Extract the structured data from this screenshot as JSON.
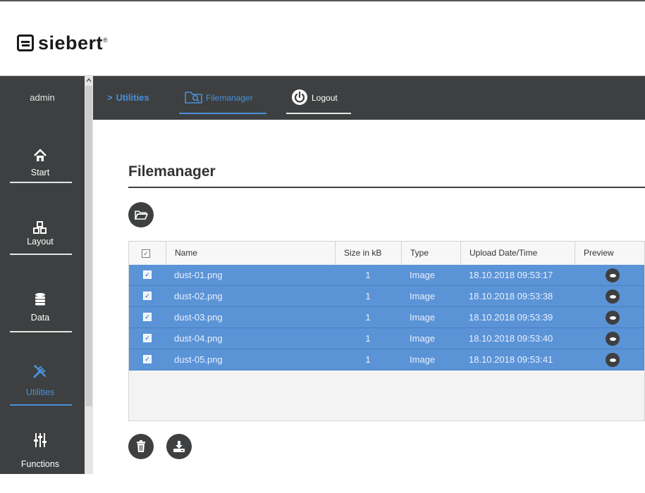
{
  "brand": {
    "name": "siebert",
    "mark": "®"
  },
  "sidebar": {
    "user": "admin",
    "items": [
      {
        "label": "Start",
        "icon": "home-icon"
      },
      {
        "label": "Layout",
        "icon": "layout-icon"
      },
      {
        "label": "Data",
        "icon": "database-icon"
      },
      {
        "label": "Utilities",
        "icon": "tools-icon",
        "active": true
      },
      {
        "label": "Functions",
        "icon": "sliders-icon"
      }
    ]
  },
  "nav": {
    "breadcrumb_chevron": ">",
    "breadcrumb": "Utilities",
    "filemanager_label": "Filemanager",
    "logout_label": "Logout"
  },
  "page": {
    "title": "Filemanager"
  },
  "table": {
    "columns": [
      "Name",
      "Size in kB",
      "Type",
      "Upload Date/Time",
      "Preview"
    ],
    "rows": [
      {
        "name": "dust-01.png",
        "size": "1",
        "type": "Image",
        "uploaded": "18.10.2018 09:53:17"
      },
      {
        "name": "dust-02.png",
        "size": "1",
        "type": "Image",
        "uploaded": "18.10.2018 09:53:38"
      },
      {
        "name": "dust-03.png",
        "size": "1",
        "type": "Image",
        "uploaded": "18.10.2018 09:53:39"
      },
      {
        "name": "dust-04.png",
        "size": "1",
        "type": "Image",
        "uploaded": "18.10.2018 09:53:40"
      },
      {
        "name": "dust-05.png",
        "size": "1",
        "type": "Image",
        "uploaded": "18.10.2018 09:53:41"
      }
    ]
  },
  "colors": {
    "accent": "#4a90d9",
    "selected_row": "#5b93d7",
    "dark": "#3d3f40"
  }
}
